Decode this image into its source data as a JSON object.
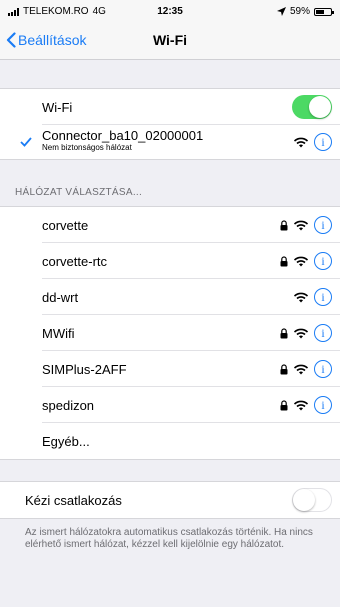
{
  "status_bar": {
    "carrier": "TELEKOM.RO",
    "network": "4G",
    "time": "12:35",
    "battery": "59%",
    "battery_level": 0.59
  },
  "nav": {
    "back_label": "Beállítások",
    "title": "Wi-Fi"
  },
  "wifi": {
    "label": "Wi-Fi",
    "enabled": true,
    "connected_name": "Connector_ba10_02000001",
    "connected_subtitle": "Nem biztonságos hálózat"
  },
  "networks_header": "HÁLÓZAT VÁLASZTÁSA...",
  "networks": [
    {
      "name": "corvette",
      "secured": true
    },
    {
      "name": "corvette-rtc",
      "secured": true
    },
    {
      "name": "dd-wrt",
      "secured": false
    },
    {
      "name": "MWifi",
      "secured": true
    },
    {
      "name": "SIMPlus-2AFF",
      "secured": true
    },
    {
      "name": "spedizon",
      "secured": true
    }
  ],
  "other_label": "Egyéb...",
  "manual": {
    "label": "Kézi csatlakozás",
    "enabled": false,
    "footer": "Az ismert hálózatokra automatikus csatlakozás történik. Ha nincs elérhető ismert hálózat, kézzel kell kijelölnie egy hálózatot."
  },
  "colors": {
    "accent": "#1a7cf5",
    "toggle_on": "#4cd964",
    "background": "#efeff4"
  }
}
